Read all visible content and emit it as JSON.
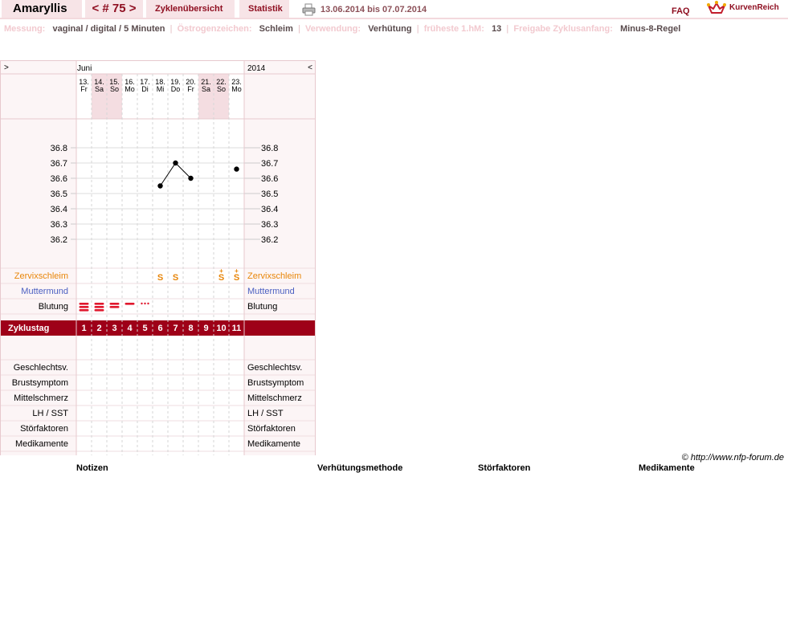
{
  "nav": {
    "user": "Amaryllis",
    "cycle": "< # 75 >",
    "overview": "Zyklenübersicht",
    "statistics": "Statistik",
    "date_range": "13.06.2014 bis 07.07.2014",
    "faq": "FAQ",
    "logo": "KurvenReich"
  },
  "info": {
    "measurement_label": "Messung:",
    "measurement_value": "vaginal / digital / 5 Minuten",
    "estrogen_label": "Östrogenzeichen:",
    "estrogen_value": "Schleim",
    "usage_label": "Verwendung:",
    "usage_value": "Verhütung",
    "earliest_label": "früheste 1.hM:",
    "earliest_value": "13",
    "release_label": "Freigabe Zyklusanfang:",
    "release_value": "Minus-8-Regel"
  },
  "chart": {
    "nav_left": ">",
    "nav_right": "<",
    "month": "Juni",
    "year": "2014",
    "days": [
      {
        "d": "13.",
        "w": "Fr",
        "weekend": false
      },
      {
        "d": "14.",
        "w": "Sa",
        "weekend": true
      },
      {
        "d": "15.",
        "w": "So",
        "weekend": true
      },
      {
        "d": "16.",
        "w": "Mo",
        "weekend": false
      },
      {
        "d": "17.",
        "w": "Di",
        "weekend": false
      },
      {
        "d": "18.",
        "w": "Mi",
        "weekend": false
      },
      {
        "d": "19.",
        "w": "Do",
        "weekend": false
      },
      {
        "d": "20.",
        "w": "Fr",
        "weekend": false
      },
      {
        "d": "21.",
        "w": "Sa",
        "weekend": true
      },
      {
        "d": "22.",
        "w": "So",
        "weekend": true
      },
      {
        "d": "23.",
        "w": "Mo",
        "weekend": false
      }
    ],
    "temp_labels": [
      "36.8",
      "36.7",
      "36.6",
      "36.5",
      "36.4",
      "36.3",
      "36.2"
    ],
    "temps": [
      null,
      null,
      null,
      null,
      null,
      36.55,
      36.7,
      36.6,
      null,
      null,
      36.66
    ],
    "cervix_label": "Zervixschleim",
    "cervix": [
      "",
      "",
      "",
      "",
      "",
      "S",
      "S",
      "",
      "",
      "S+",
      "S+"
    ],
    "cervix_color": "#e8860a",
    "cm_label": "Muttermund",
    "cm_color": "#4a5fc1",
    "bleeding_label": "Blutung",
    "bleeding": [
      3,
      3,
      2,
      1,
      0.5,
      0,
      0,
      0,
      0,
      0,
      0
    ],
    "bleeding_color": "#e0182d",
    "cycle_label": "Zyklustag",
    "cycle_days": [
      "1",
      "2",
      "3",
      "4",
      "5",
      "6",
      "7",
      "8",
      "9",
      "10",
      "11"
    ],
    "accent": "#9e0018",
    "symptom_rows": [
      "Geschlechtsv.",
      "Brustsymptom",
      "Mittelschmerz",
      "LH / SST",
      "Störfaktoren",
      "Medikamente",
      "Notizen"
    ]
  },
  "footer": {
    "copyright": "© http://www.nfp-forum.de",
    "notes": "Notizen",
    "contraception": "Verhütungsmethode",
    "disruptors": "Störfaktoren",
    "medication": "Medikamente"
  }
}
